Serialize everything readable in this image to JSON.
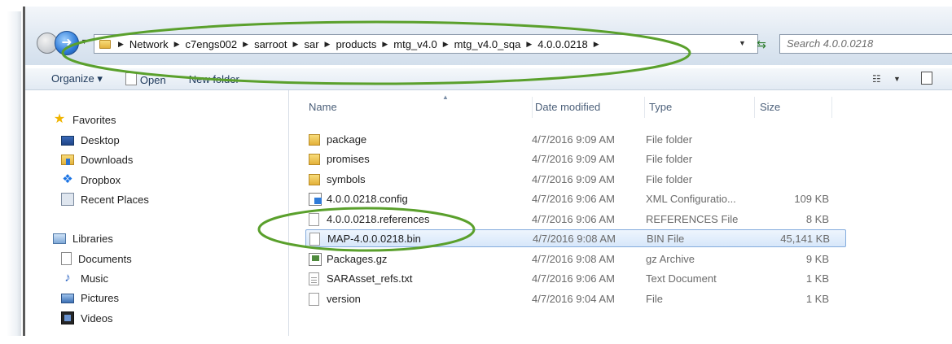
{
  "breadcrumb": {
    "segments": [
      "Network",
      "c7engs002",
      "sarroot",
      "sar",
      "products",
      "mtg_v4.0",
      "mtg_v4.0_sqa",
      "4.0.0.0218"
    ]
  },
  "search": {
    "placeholder": "Search 4.0.0.0218"
  },
  "toolbar": {
    "organize_label": "Organize ▾",
    "open_label": "Open",
    "new_folder_label": "New folder"
  },
  "nav": {
    "favorites": {
      "label": "Favorites",
      "items": [
        {
          "label": "Desktop",
          "icon": "desktop-icon"
        },
        {
          "label": "Downloads",
          "icon": "downloads-icon"
        },
        {
          "label": "Dropbox",
          "icon": "dropbox-icon"
        },
        {
          "label": "Recent Places",
          "icon": "recent-places-icon"
        }
      ]
    },
    "libraries": {
      "label": "Libraries",
      "items": [
        {
          "label": "Documents",
          "icon": "documents-icon"
        },
        {
          "label": "Music",
          "icon": "music-icon"
        },
        {
          "label": "Pictures",
          "icon": "pictures-icon"
        },
        {
          "label": "Videos",
          "icon": "videos-icon"
        }
      ]
    }
  },
  "columns": {
    "name": "Name",
    "date": "Date modified",
    "type": "Type",
    "size": "Size"
  },
  "files": [
    {
      "name": "package",
      "date": "4/7/2016 9:09 AM",
      "type": "File folder",
      "size": "",
      "icon": "folder-icon"
    },
    {
      "name": "promises",
      "date": "4/7/2016 9:09 AM",
      "type": "File folder",
      "size": "",
      "icon": "folder-icon"
    },
    {
      "name": "symbols",
      "date": "4/7/2016 9:09 AM",
      "type": "File folder",
      "size": "",
      "icon": "folder-icon"
    },
    {
      "name": "4.0.0.0218.config",
      "date": "4/7/2016 9:06 AM",
      "type": "XML Configuratio...",
      "size": "109 KB",
      "icon": "config-file-icon"
    },
    {
      "name": "4.0.0.0218.references",
      "date": "4/7/2016 9:06 AM",
      "type": "REFERENCES File",
      "size": "8 KB",
      "icon": "generic-file-icon"
    },
    {
      "name": "MAP-4.0.0.0218.bin",
      "date": "4/7/2016 9:08 AM",
      "type": "BIN File",
      "size": "45,141 KB",
      "icon": "generic-file-icon",
      "selected": true
    },
    {
      "name": "Packages.gz",
      "date": "4/7/2016 9:08 AM",
      "type": "gz Archive",
      "size": "9 KB",
      "icon": "archive-icon"
    },
    {
      "name": "SARAsset_refs.txt",
      "date": "4/7/2016 9:06 AM",
      "type": "Text Document",
      "size": "1 KB",
      "icon": "text-file-icon"
    },
    {
      "name": "version",
      "date": "4/7/2016 9:04 AM",
      "type": "File",
      "size": "1 KB",
      "icon": "generic-file-icon"
    }
  ],
  "colors": {
    "annotation": "#5aa02c",
    "selection": "#d7e7fa",
    "link": "#1e395b"
  }
}
